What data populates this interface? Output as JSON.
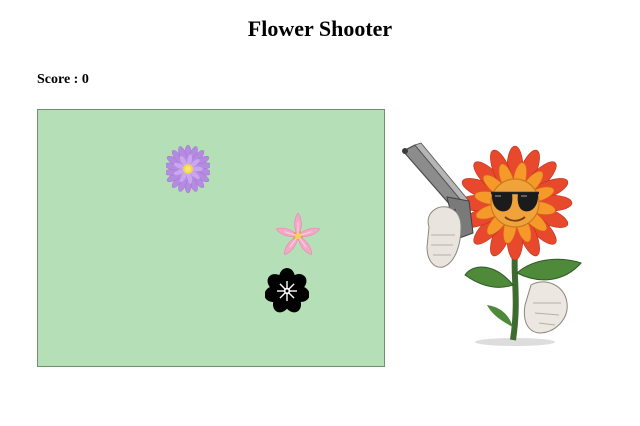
{
  "title": "Flower Shooter",
  "score": {
    "label": "Score : ",
    "value": "0"
  },
  "game": {
    "background_color": "#b5dfb7",
    "targets": [
      {
        "name": "purple-flower-target",
        "icon": "purple-daisy-icon",
        "color": "#b48be0"
      },
      {
        "name": "pink-flower-target",
        "icon": "pink-lily-icon",
        "color": "#f4a7c6"
      },
      {
        "name": "black-flower-target",
        "icon": "black-flower-icon",
        "color": "#000000"
      }
    ]
  },
  "mascot": {
    "icon": "sunflower-with-gun-icon"
  }
}
